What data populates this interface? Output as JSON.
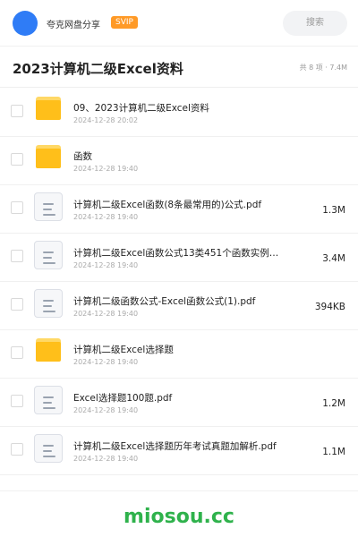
{
  "header": {
    "share_name": "夸克网盘分享",
    "badge": "SVIP",
    "search_placeholder": "搜索"
  },
  "folder": {
    "title": "2023计算机二级Excel资料",
    "meta": "共 8 项 · 7.4M"
  },
  "items": [
    {
      "type": "folder",
      "name": "09、2023计算机二级Excel资料",
      "date": "2024-12-28 20:02",
      "size": ""
    },
    {
      "type": "folder",
      "name": "函数",
      "date": "2024-12-28 19:40",
      "size": ""
    },
    {
      "type": "file",
      "name": "计算机二级Excel函数(8条最常用的)公式.pdf",
      "date": "2024-12-28 19:40",
      "size": "1.3M"
    },
    {
      "type": "file",
      "name": "计算机二级Excel函数公式13类451个函数实例…",
      "date": "2024-12-28 19:40",
      "size": "3.4M"
    },
    {
      "type": "file",
      "name": "计算机二级函数公式-Excel函数公式(1).pdf",
      "date": "2024-12-28 19:40",
      "size": "394KB"
    },
    {
      "type": "folder",
      "name": "计算机二级Excel选择题",
      "date": "2024-12-28 19:40",
      "size": ""
    },
    {
      "type": "file",
      "name": "Excel选择题100题.pdf",
      "date": "2024-12-28 19:40",
      "size": "1.2M"
    },
    {
      "type": "file",
      "name": "计算机二级Excel选择题历年考试真题加解析.pdf",
      "date": "2024-12-28 19:40",
      "size": "1.1M"
    }
  ],
  "footer": {
    "brand": "miosou.cc"
  },
  "colors": {
    "accent": "#2f7cf6",
    "badge": "#ff9a27",
    "folder": "#ffbf1a",
    "brand": "#2fb24c"
  },
  "icons": {
    "folder": "folder-icon",
    "file": "document-icon"
  }
}
